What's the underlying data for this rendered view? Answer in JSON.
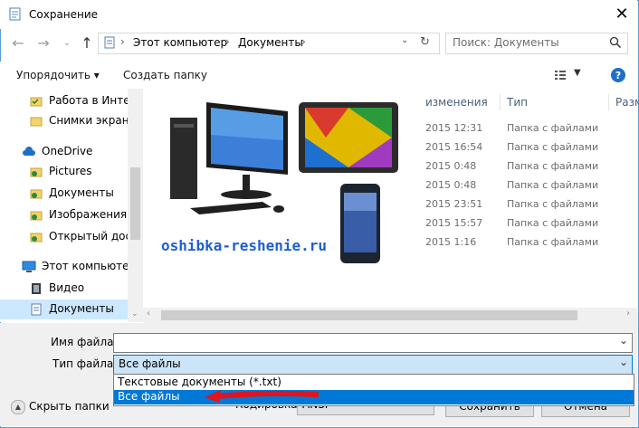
{
  "window": {
    "title": "Сохранение",
    "accent": "#0078d7"
  },
  "address": {
    "crumbs": [
      "Этот компьютер",
      "Документы"
    ]
  },
  "search": {
    "placeholder": "Поиск: Документы"
  },
  "toolbar": {
    "organize": "Упорядочить ▾",
    "new_folder": "Создать папку"
  },
  "sidebar": {
    "items": [
      {
        "label": "Работа в Интер",
        "icon": "folder-icon"
      },
      {
        "label": "Снимки экрана",
        "icon": "folder-icon"
      },
      {
        "label": "OneDrive",
        "icon": "cloud-icon"
      },
      {
        "label": "Pictures",
        "icon": "folder-icon"
      },
      {
        "label": "Документы",
        "icon": "folder-icon"
      },
      {
        "label": "Изображения",
        "icon": "folder-icon"
      },
      {
        "label": "Открытый дост",
        "icon": "folder-icon"
      },
      {
        "label": "Этот компьютер",
        "icon": "computer-icon"
      },
      {
        "label": "Видео",
        "icon": "video-icon"
      },
      {
        "label": "Документы",
        "icon": "document-icon"
      }
    ]
  },
  "columns": {
    "modified": "изменения",
    "type": "Тип",
    "size": "Разм"
  },
  "files": [
    {
      "date": "2015 12:31",
      "type": "Папка с файлами"
    },
    {
      "date": "2015 16:54",
      "type": "Папка с файлами"
    },
    {
      "date": "2015 0:48",
      "type": "Папка с файлами"
    },
    {
      "date": "2015 0:48",
      "type": "Папка с файлами"
    },
    {
      "date": "2015 23:51",
      "type": "Папка с файлами"
    },
    {
      "date": "2015 15:57",
      "type": "Папка с файлами"
    },
    {
      "date": "2015 1:16",
      "type": "Папка с файлами"
    }
  ],
  "overlay": {
    "watermark": "oshibka-reshenie.ru"
  },
  "form": {
    "filename_label": "Имя файла:",
    "filename_value": "",
    "filetype_label": "Тип файла:",
    "filetype_value": "Все файлы",
    "options": [
      "Текстовые документы (*.txt)",
      "Все файлы"
    ],
    "encoding_label": "Кодировка:",
    "encoding_value": "ANSI",
    "hide_folders": "Скрыть папки",
    "save": "Сохранить",
    "cancel": "Отмена"
  }
}
